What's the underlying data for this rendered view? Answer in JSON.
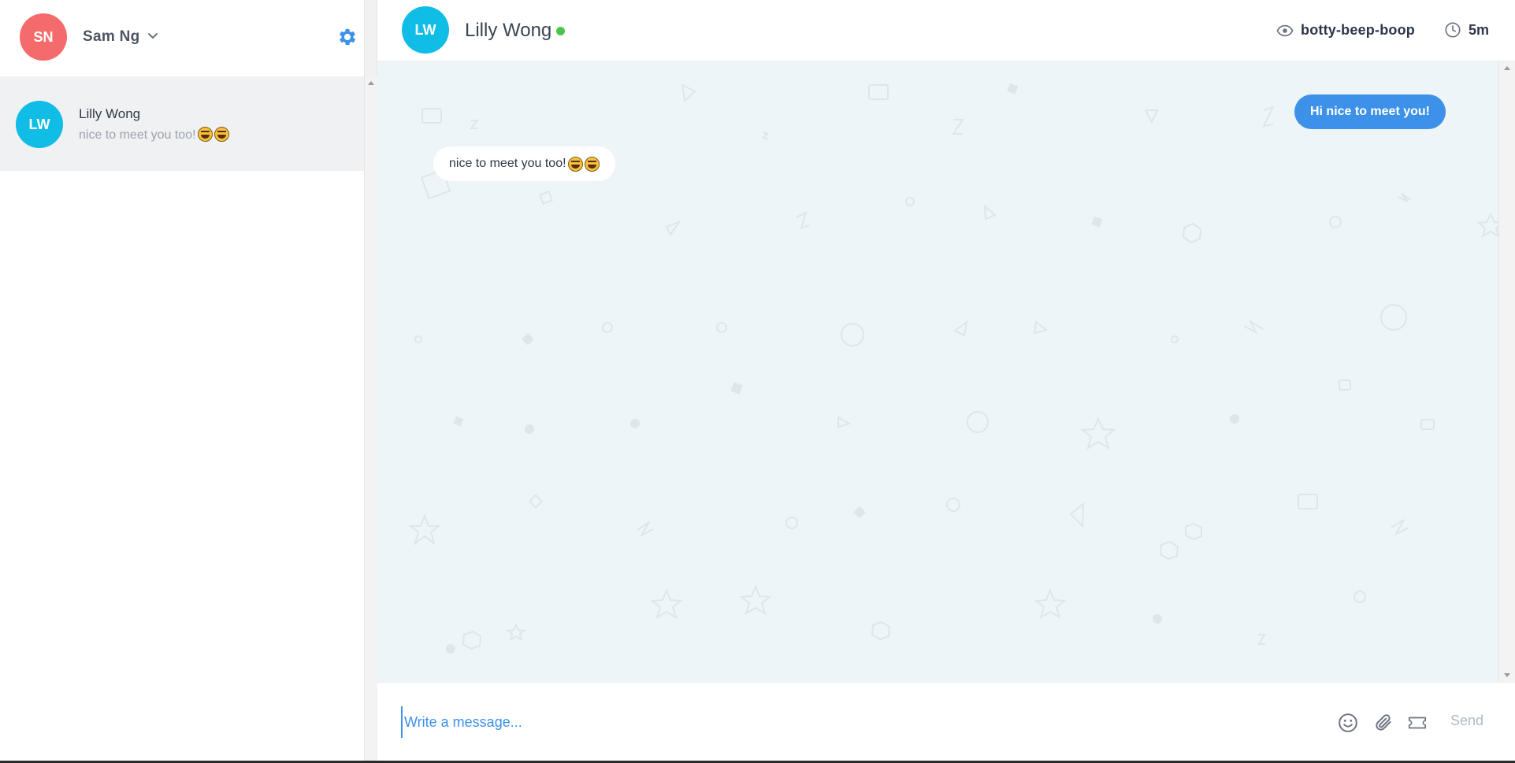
{
  "current_user": {
    "initials": "SN",
    "name": "Sam Ng",
    "avatar_color": "#f56b6b"
  },
  "conversations": [
    {
      "initials": "LW",
      "name": "Lilly Wong",
      "preview": "nice to meet you too!",
      "avatar_color": "#10bde6",
      "selected": true
    }
  ],
  "chat": {
    "contact_initials": "LW",
    "contact_name": "Lilly Wong",
    "online": true,
    "channel": "botty-beep-boop",
    "time_ago": "5m",
    "messages": [
      {
        "direction": "outgoing",
        "text": "Hi nice to meet you!"
      },
      {
        "direction": "incoming",
        "text": "nice to meet you too!"
      }
    ]
  },
  "composer": {
    "placeholder": "Write a message...",
    "send_label": "Send"
  },
  "colors": {
    "accent": "#3d91e8",
    "online": "#4ec34e",
    "chat_background": "#eef5f8"
  }
}
